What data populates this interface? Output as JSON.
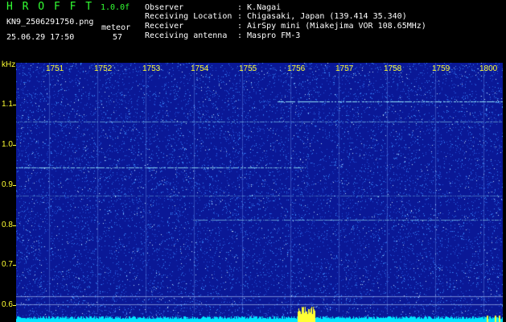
{
  "header": {
    "app_title": "H R O F F T",
    "version": "1.0.0f",
    "file_name": "KN9_2506291750.png",
    "mode": "meteor",
    "datetime": "25.06.29 17:50",
    "count": "57"
  },
  "info": {
    "observer_label": "Observer",
    "observer_value": ": K.Nagai",
    "location_label": "Receiving Location",
    "location_value": ": Chigasaki, Japan (139.414 35.340)",
    "receiver_label": "Receiver",
    "receiver_value": ": AirSpy mini (Miakejima VOR 108.65MHz)",
    "antenna_label": "Receiving antenna",
    "antenna_value": ": Maspro FM-3"
  },
  "axis": {
    "unit": "kHz",
    "y_ticks": [
      "1.1",
      "1.0",
      "0.9",
      "0.8",
      "0.7",
      "0.6"
    ],
    "time_labels": [
      "1751",
      "1752",
      "1753",
      "1754",
      "1755",
      "1756",
      "1757",
      "1758",
      "1759",
      "1800"
    ]
  },
  "colors": {
    "background": "#0a1896",
    "noise": "#3a8fff",
    "signal": "#9ef7ff",
    "baseline": "#00e5ff",
    "spike": "#ffff33",
    "text_green": "#33ff33",
    "text_yellow": "#ffff33"
  }
}
